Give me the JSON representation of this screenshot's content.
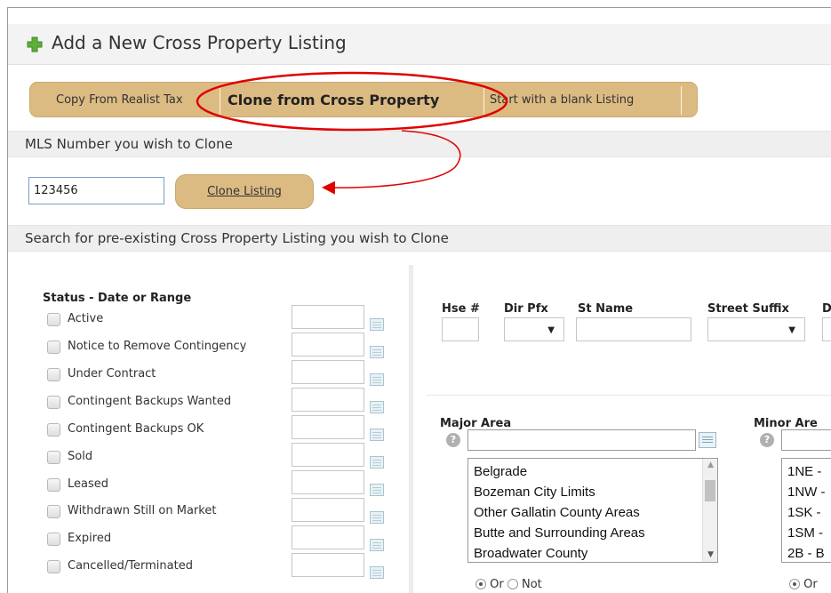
{
  "header": {
    "title": "Add a New Cross Property Listing"
  },
  "tabs": [
    {
      "label": "Copy From Realist Tax"
    },
    {
      "label": "Clone from Cross Property"
    },
    {
      "label": "Start with a blank Listing"
    }
  ],
  "clone": {
    "section_label": "MLS Number you wish to Clone",
    "mls_value": "123456",
    "button_label": "Clone Listing"
  },
  "search": {
    "section_label": "Search for pre-existing Cross Property Listing you wish to Clone"
  },
  "status": {
    "title": "Status - Date or Range",
    "items": [
      {
        "label": "Active"
      },
      {
        "label": "Notice to Remove Contingency"
      },
      {
        "label": "Under Contract"
      },
      {
        "label": "Contingent Backups Wanted"
      },
      {
        "label": "Contingent Backups OK"
      },
      {
        "label": "Sold"
      },
      {
        "label": "Leased"
      },
      {
        "label": "Withdrawn Still on Market"
      },
      {
        "label": "Expired"
      },
      {
        "label": "Cancelled/Terminated"
      }
    ]
  },
  "address": {
    "hse_label": "Hse #",
    "dir_label": "Dir Pfx",
    "street_label": "St Name",
    "suffix_label": "Street Suffix",
    "next_label": "D"
  },
  "major_area": {
    "label": "Major Area",
    "options": [
      "Belgrade",
      "Bozeman City Limits",
      "Other Gallatin County Areas",
      "Butte and Surrounding Areas",
      "Broadwater County"
    ],
    "or_label": "Or",
    "not_label": "Not"
  },
  "minor_area": {
    "label": "Minor Are",
    "options": [
      "1NE -",
      "1NW -",
      "1SK -",
      "1SM -",
      "2B - B"
    ],
    "or_label": "Or"
  },
  "icons": {
    "title": "plus-icon",
    "date": "calendar-icon",
    "help": "help-icon",
    "lookup": "list-lookup-icon"
  },
  "colors": {
    "tab_tan": "#dcbb83",
    "plus_green": "#5fae3a",
    "annotation_red": "#e00000",
    "input_border": "#7a9cc9"
  }
}
